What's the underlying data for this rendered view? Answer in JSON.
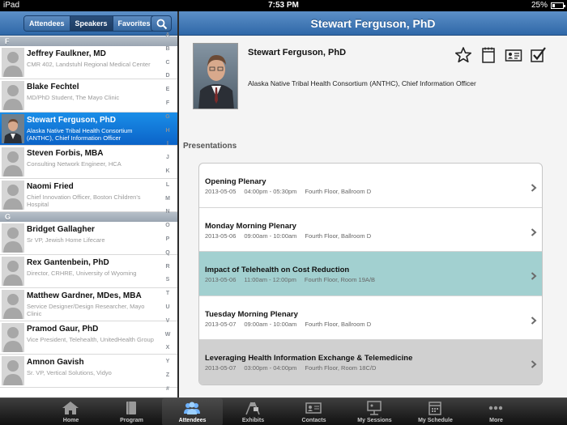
{
  "status_bar": {
    "carrier": "iPad",
    "time": "7:53 PM",
    "battery": "25%"
  },
  "left_nav": {
    "segments": [
      {
        "label": "Attendees",
        "active": false
      },
      {
        "label": "Speakers",
        "active": true
      },
      {
        "label": "Favorites",
        "active": false
      }
    ],
    "search_icon": "search-icon"
  },
  "list": {
    "sections": [
      {
        "letter": "F",
        "rows": [
          {
            "name": "Jeffrey Faulkner, MD",
            "subtitle": "CMR 402, Landstuhl Regional Medical Center",
            "selected": false
          },
          {
            "name": "Blake Fechtel",
            "subtitle": "MD/PhD Student, The Mayo Clinic",
            "selected": false
          },
          {
            "name": "Stewart Ferguson, PhD",
            "subtitle": "Alaska Native Tribal Health Consortium (ANTHC), Chief Information Officer",
            "selected": true
          },
          {
            "name": "Steven Forbis, MBA",
            "subtitle": "Consulting Network Engineer, HCA",
            "selected": false
          },
          {
            "name": "Naomi Fried",
            "subtitle": "Chief Innovation Officer, Boston Children's Hospital",
            "selected": false
          }
        ]
      },
      {
        "letter": "G",
        "rows": [
          {
            "name": "Bridget Gallagher",
            "subtitle": "Sr VP, Jewish Home Lifecare",
            "selected": false
          },
          {
            "name": "Rex Gantenbein, PhD",
            "subtitle": "Director, CRHRE, University of Wyoming",
            "selected": false
          },
          {
            "name": "Matthew Gardner, MDes, MBA",
            "subtitle": "Service Designer/Design Researcher, Mayo Clinic",
            "selected": false
          },
          {
            "name": "Pramod Gaur, PhD",
            "subtitle": "Vice President, Telehealth, UnitedHealth Group",
            "selected": false
          },
          {
            "name": "Amnon Gavish",
            "subtitle": "Sr. VP, Vertical Solutions, Vidyo",
            "selected": false
          }
        ]
      }
    ],
    "index_letters": [
      "A",
      "B",
      "C",
      "D",
      "E",
      "F",
      "G",
      "H",
      "I",
      "J",
      "K",
      "L",
      "M",
      "N",
      "O",
      "P",
      "Q",
      "R",
      "S",
      "T",
      "U",
      "V",
      "W",
      "X",
      "Y",
      "Z",
      "#"
    ]
  },
  "detail": {
    "title": "Stewart Ferguson, PhD",
    "name": "Stewart Ferguson, PhD",
    "organization": "Alaska Native Tribal Health Consortium (ANTHC), Chief Information Officer",
    "actions": [
      "star-icon",
      "calendar-icon",
      "contact-card-icon",
      "checkbox-icon"
    ],
    "presentations_label": "Presentations",
    "presentations": [
      {
        "title": "Opening Plenary",
        "date": "2013-05-05",
        "time": "04:00pm - 05:30pm",
        "location": "Fourth Floor, Ballroom D",
        "style": "normal"
      },
      {
        "title": "Monday Morning Plenary",
        "date": "2013-05-06",
        "time": "09:00am - 10:00am",
        "location": "Fourth Floor, Ballroom D",
        "style": "normal"
      },
      {
        "title": "Impact of Telehealth on Cost Reduction",
        "date": "2013-05-06",
        "time": "11:00am - 12:00pm",
        "location": "Fourth Floor, Room 19A/B",
        "style": "highlight"
      },
      {
        "title": "Tuesday Morning Plenary",
        "date": "2013-05-07",
        "time": "09:00am - 10:00am",
        "location": "Fourth Floor, Ballroom D",
        "style": "normal"
      },
      {
        "title": "Leveraging  Health Information Exchange & Telemedicine",
        "date": "2013-05-07",
        "time": "03:00pm - 04:00pm",
        "location": "Fourth Floor, Room 18C/D",
        "style": "gray"
      }
    ]
  },
  "tabbar": [
    {
      "label": "Home",
      "icon": "home-icon",
      "active": false
    },
    {
      "label": "Program",
      "icon": "book-icon",
      "active": false
    },
    {
      "label": "Attendees",
      "icon": "people-icon",
      "active": true
    },
    {
      "label": "Exhibits",
      "icon": "flags-icon",
      "active": false
    },
    {
      "label": "Contacts",
      "icon": "contact-card-icon",
      "active": false
    },
    {
      "label": "My Sessions",
      "icon": "presentation-icon",
      "active": false
    },
    {
      "label": "My Schedule",
      "icon": "calendar-icon",
      "active": false
    },
    {
      "label": "More",
      "icon": "more-dots-icon",
      "active": false
    }
  ],
  "colors": {
    "nav_blue": "#3d74b5",
    "selected_row": "#1279d8",
    "highlight_row": "#a2d0d0"
  }
}
